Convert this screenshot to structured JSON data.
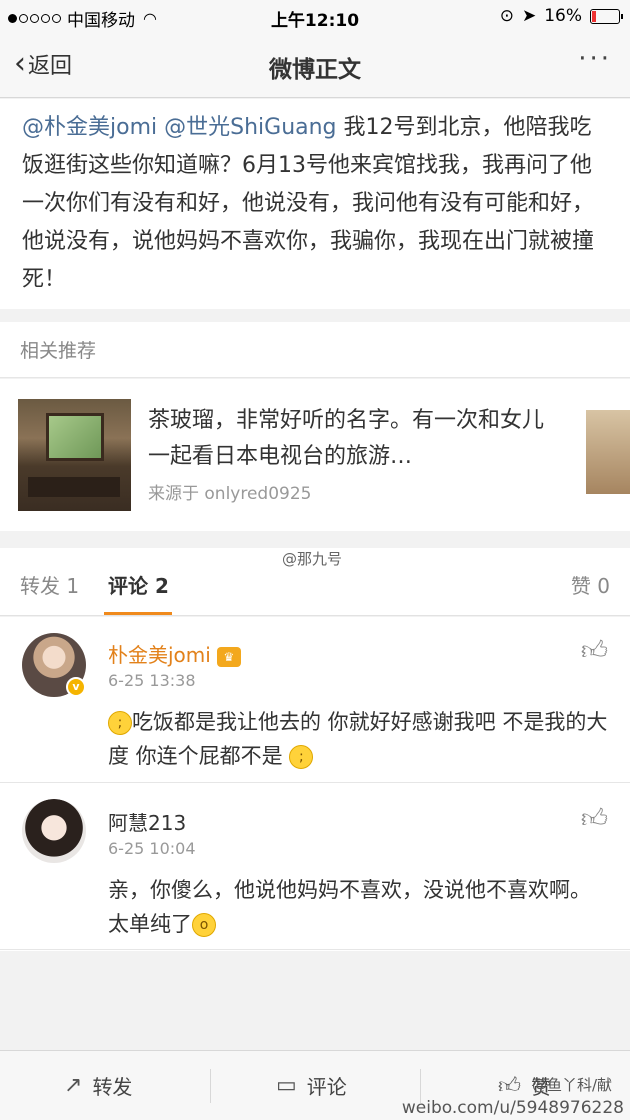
{
  "status": {
    "carrier": "中国移动",
    "time": "上午12:10",
    "battery": "16%",
    "battery_level": 0.16
  },
  "nav": {
    "back_label": "返回",
    "title": "微博正文",
    "more_label": "···"
  },
  "post": {
    "mention1": "@朴金美jomi",
    "mention2": "@世光ShiGuang",
    "text": " 我12号到北京，他陪我吃饭逛街这些你知道嘛？6月13号他来宾馆找我，我再问了他一次你们有没有和好，他说没有，我问他有没有可能和好，他说没有，说他妈妈不喜欢你，我骗你，我现在出门就被撞死！"
  },
  "related": {
    "header": "相关推荐",
    "text": "茶玻瑠，非常好听的名字。有一次和女儿一起看日本电视台的旅游…",
    "source": "来源于 onlyred0925"
  },
  "tabs": {
    "repost": "转发 1",
    "comment": "评论 2",
    "like": "赞 0"
  },
  "watermark_mid": "@那九号",
  "comments": [
    {
      "name": "朴金美jomi",
      "time": "6-25 13:38",
      "text": "吃饭都是我让他去的 你就好好感谢我吧 不是我的大度 你连个屁都不是 "
    },
    {
      "name": "阿慧213",
      "time": "6-25 10:04",
      "text": "亲，你傻么，他说他妈妈不喜欢，没说他不喜欢啊。太单纯了"
    }
  ],
  "toolbar": {
    "repost": "转发",
    "comment": "评论",
    "like": "赞"
  },
  "watermark_br": "weibo.com/u/5948976228",
  "watermark_br2": "@鱼丫科/献"
}
